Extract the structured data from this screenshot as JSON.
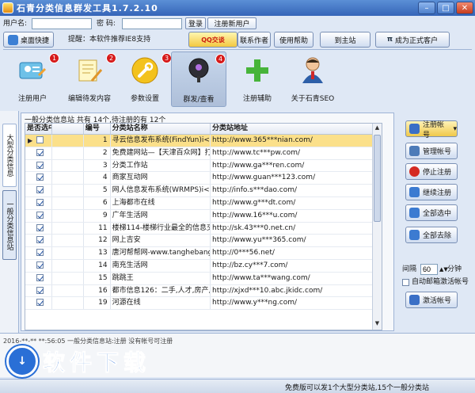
{
  "window": {
    "title": "石青分类信息群发工具1.7.2.10"
  },
  "login": {
    "username_label": "用户名:",
    "password_label": "密 码:",
    "login_button": "登录",
    "register_button": "注册新用户",
    "username_value": "",
    "password_value": ""
  },
  "toolbar": {
    "home_button": "桌面快捷",
    "notice": "提醒：本软件推荐IE8支持",
    "contact_button": "联系作者",
    "help_button": "使用帮助",
    "site_button": "到主站",
    "upgrade_button": "成为正式客户",
    "qq_label": "QQ交谈"
  },
  "nav": [
    {
      "label": "注册用户",
      "badge": "1"
    },
    {
      "label": "编辑待发内容",
      "badge": "2"
    },
    {
      "label": "参数设置",
      "badge": "3"
    },
    {
      "label": "群发/查看",
      "badge": "4"
    },
    {
      "label": "注册辅助",
      "badge": ""
    },
    {
      "label": "关于石青SEO",
      "badge": ""
    }
  ],
  "side_tabs": {
    "big": "大型分类信息",
    "general": "一般分类信息站"
  },
  "group": {
    "title": "一般分类信息站 共有 14个,待注册的有 12个"
  },
  "table": {
    "headers": [
      "是否选中",
      "编号",
      "分类站名称",
      "分类站地址"
    ],
    "rows": [
      {
        "checked": false,
        "num": "1",
        "name": "寻云信息发布系统(FindYun)i<<最",
        "url": "http://www.365***nian.com/"
      },
      {
        "checked": true,
        "num": "2",
        "name": "免费建网站—【天津百众网】打造",
        "url": "http://www.tc***pw.com/"
      },
      {
        "checked": true,
        "num": "3",
        "name": "分类工作站",
        "url": "http://www.ga***ren.com/"
      },
      {
        "checked": true,
        "num": "4",
        "name": "商家互动网",
        "url": "http://www.guan***123.com/"
      },
      {
        "checked": true,
        "num": "5",
        "name": "网人信息发布系统(WRMPS)i<<最",
        "url": "http://info.s***dao.com/"
      },
      {
        "checked": true,
        "num": "6",
        "name": "上海都市在线",
        "url": "http://www.g***dt.com/"
      },
      {
        "checked": true,
        "num": "9",
        "name": "广年生活网",
        "url": "http://www.16***u.com/"
      },
      {
        "checked": true,
        "num": "11",
        "name": "楼梯114-楼梯行业最全的信息交流",
        "url": "http://sk.43***0.net.cn/"
      },
      {
        "checked": true,
        "num": "12",
        "name": "网上吉安",
        "url": "http://www.yu***365.com/"
      },
      {
        "checked": true,
        "num": "13",
        "name": "唐河帮帮网-www.tanghebangbang",
        "url": "http://0***56.net/"
      },
      {
        "checked": true,
        "num": "14",
        "name": "南充生活网",
        "url": "http://bz.cy***7.com/"
      },
      {
        "checked": true,
        "num": "15",
        "name": "跳跳王",
        "url": "http://www.ta***wang.com/"
      },
      {
        "checked": true,
        "num": "16",
        "name": "都市信息126：二手,人才,房产,免费",
        "url": "http://xjxd***10.abc.jkidc.com/"
      },
      {
        "checked": true,
        "num": "19",
        "name": "河源在线",
        "url": "http://www.y***ng.com/"
      }
    ]
  },
  "right": {
    "register_account": "注册帐号",
    "manage_account": "管理帐号",
    "stop_register": "停止注册",
    "continue_register": "继续注册",
    "select_all": "全部选中",
    "deselect_all": "全部去除",
    "interval_label": "间隔",
    "interval_value": "60",
    "interval_unit": "分钟",
    "auto_activate": "自动邮箱激活帐号",
    "activate_button": "激活帐号"
  },
  "log": {
    "line": "2016-**-** **:56:05 一般分类信息站:注册 没有帐号可注册"
  },
  "watermark": {
    "text": "软件下载"
  },
  "status": {
    "text": "免费版可以发1个大型分类站,15个一般分类站"
  }
}
